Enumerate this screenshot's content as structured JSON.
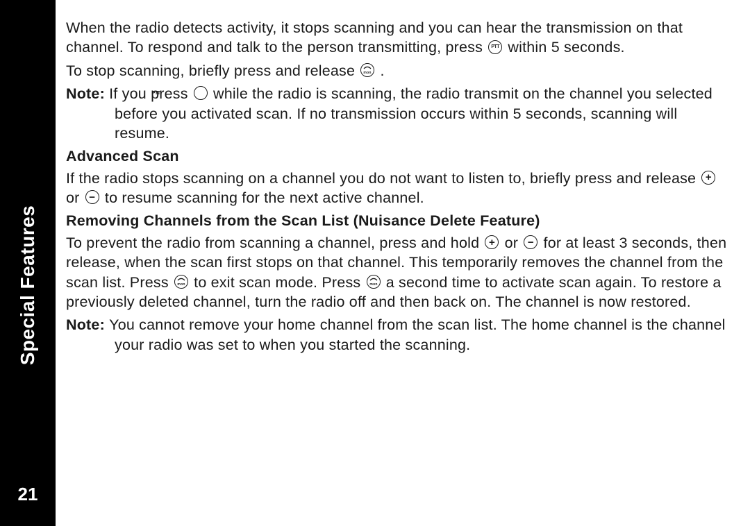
{
  "sidebar": {
    "title": "Special Features",
    "page": "21"
  },
  "body": {
    "p1a": "When the radio detects activity, it stops scanning and you can hear the transmission on that channel. To respond and talk to the person transmitting, press ",
    "p1b": " within 5 seconds.",
    "p2a": "To stop scanning, briefly press and release ",
    "p2b": " .",
    "note1_label": "Note: ",
    "note1a": "If you press ",
    "note1b": " while the radio is scanning, the radio transmit on the channel you selected before you activated scan. If no transmission occurs within 5 seconds, scanning will resume.",
    "h1": "Advanced Scan",
    "p3a": "If the radio stops scanning on a channel you do not want to listen to, briefly press and release ",
    "p3b": " or ",
    "p3c": " to resume scanning for the next active channel.",
    "h2": "Removing Channels from the Scan List (Nuisance Delete Feature)",
    "p4a": "To prevent the radio from scanning a channel, press and hold ",
    "p4b": "or ",
    "p4c": " for at least 3 seconds, then release, when the scan first stops on that channel. This temporarily removes the channel from the scan list. Press ",
    "p4d": " to exit scan mode. Press ",
    "p4e": " a second time to activate scan again. To restore a previously deleted channel, turn the radio off and then back on. The channel is now restored.",
    "note2_label": "Note: ",
    "note2": "You cannot remove your home channel from the scan list. The home channel is the channel your radio was set to when you started the scanning."
  }
}
